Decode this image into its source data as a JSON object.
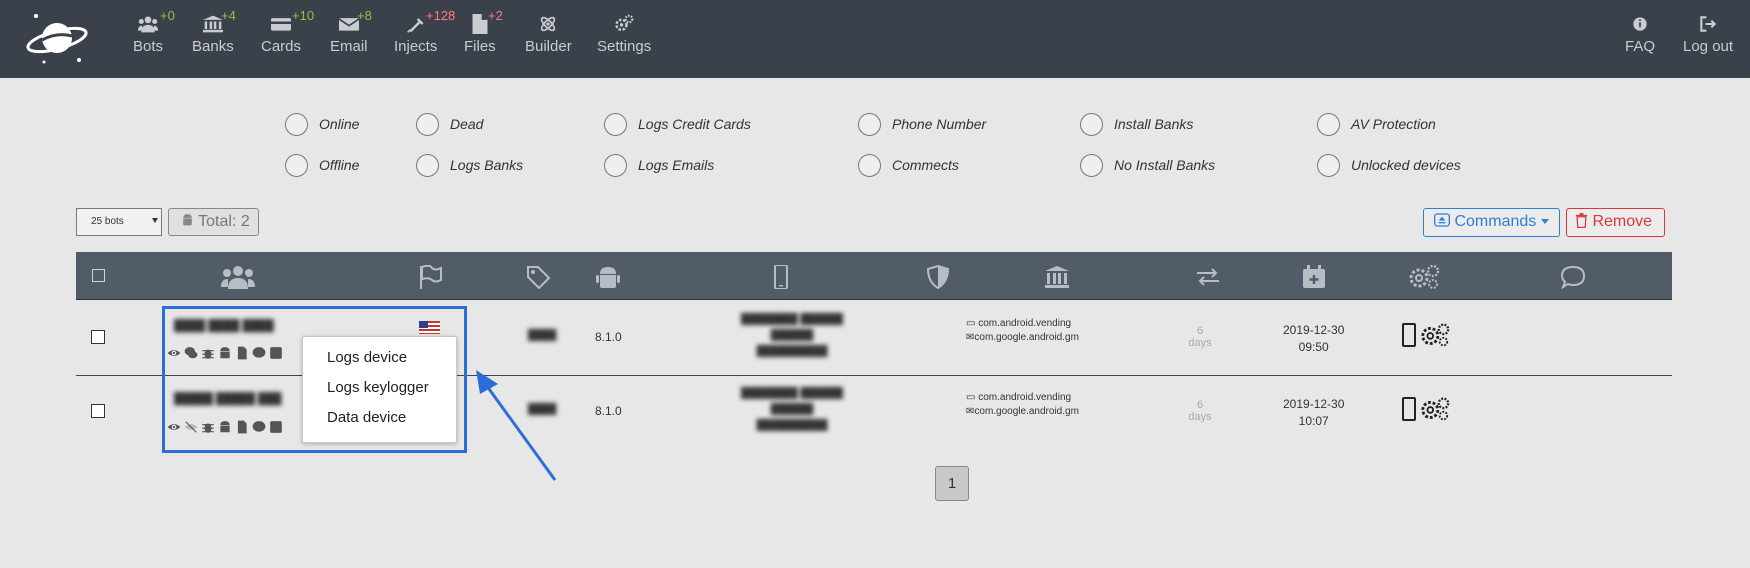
{
  "nav": {
    "items": [
      {
        "label": "Bots",
        "count": "+0",
        "icon": "users-icon",
        "count_color": "#8bc34a"
      },
      {
        "label": "Banks",
        "count": "+4",
        "icon": "bank-icon",
        "count_color": "#8bc34a"
      },
      {
        "label": "Cards",
        "count": "+10",
        "icon": "credit-card-icon",
        "count_color": "#8bc34a"
      },
      {
        "label": "Email",
        "count": "+8",
        "icon": "envelope-icon",
        "count_color": "#8bc34a"
      },
      {
        "label": "Injects",
        "count": "+128",
        "icon": "syringe-icon",
        "count_color": "#ff7b7b"
      },
      {
        "label": "Files",
        "count": "+2",
        "icon": "file-icon",
        "count_color": "#ff7b7b"
      },
      {
        "label": "Builder",
        "icon": "atom-icon"
      },
      {
        "label": "Settings",
        "icon": "gears-icon"
      }
    ],
    "faq": "FAQ",
    "logout": "Log out"
  },
  "filters": [
    "Online",
    "Dead",
    "Logs Credit Cards",
    "Phone Number",
    "Install Banks",
    "AV Protection",
    "Offline",
    "Logs Banks",
    "Logs Emails",
    "Commects",
    "No Install Banks",
    "Unlocked devices"
  ],
  "controls": {
    "per_page": "25 bots",
    "total": "Total: 2",
    "commands": "Commands",
    "remove": "Remove"
  },
  "table": {
    "header_icons": [
      "users-icon",
      "flag-icon",
      "tag-icon",
      "android-icon",
      "mobile-icon",
      "shield-icon",
      "bank-icon",
      "exchange-icon",
      "calendar-plus-icon",
      "gears-icon",
      "comment-icon"
    ],
    "rows": [
      {
        "os": "8.1.0",
        "apps": [
          "com.android.vending",
          "com.google.android.gm"
        ],
        "days": "6",
        "days_unit": "days",
        "date": "2019-12-30",
        "time": "09:50"
      },
      {
        "os": "8.1.0",
        "apps": [
          "com.android.vending",
          "com.google.android.gm"
        ],
        "days": "6",
        "days_unit": "days",
        "date": "2019-12-30",
        "time": "10:07"
      }
    ]
  },
  "context_menu": [
    "Logs device",
    "Logs keylogger",
    "Data device"
  ],
  "pagination": {
    "current": "1"
  },
  "colors": {
    "topbar": "#3a414b",
    "table_header": "#525c68",
    "accent_blue": "#2f7fd6",
    "danger": "#d9363e",
    "highlight": "#2b6fd6"
  }
}
